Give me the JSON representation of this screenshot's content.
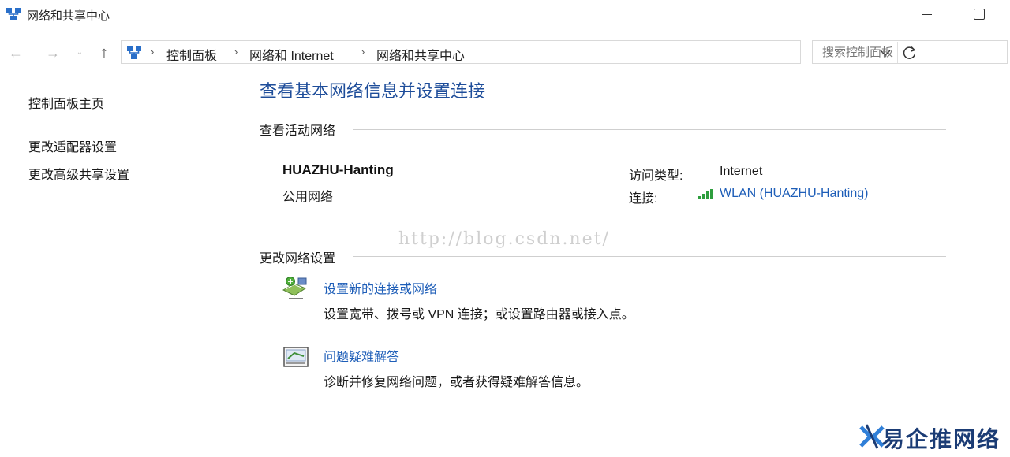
{
  "window": {
    "title": "网络和共享中心"
  },
  "navigation": {
    "back_glyph": "←",
    "forward_glyph": "→",
    "recent_glyph": "⌄",
    "up_glyph": "↑"
  },
  "address_bar": {
    "crumbs": [
      "控制面板",
      "网络和 Internet",
      "网络和共享中心"
    ],
    "separator": "›"
  },
  "search": {
    "placeholder": "搜索控制面板"
  },
  "sidebar": {
    "items": [
      {
        "label": "控制面板主页"
      },
      {
        "label": "更改适配器设置"
      },
      {
        "label": "更改高级共享设置"
      }
    ]
  },
  "main": {
    "title": "查看基本网络信息并设置连接",
    "active_networks_header": "查看活动网络",
    "network": {
      "name": "HUAZHU-Hanting",
      "type": "公用网络",
      "access_type_label": "访问类型:",
      "access_type_value": "Internet",
      "connection_label": "连接:",
      "connection_value": "WLAN (HUAZHU-Hanting)"
    },
    "watermark": "http://blog.csdn.net/",
    "change_settings_header": "更改网络设置",
    "tasks": [
      {
        "title": "设置新的连接或网络",
        "description": "设置宽带、拨号或 VPN 连接；或设置路由器或接入点。",
        "icon": "new-connection-icon"
      },
      {
        "title": "问题疑难解答",
        "description": "诊断并修复网络问题，或者获得疑难解答信息。",
        "icon": "troubleshoot-icon"
      }
    ]
  },
  "corner_brand": {
    "text": "易企推网络"
  },
  "colors": {
    "link": "#1e5eb8",
    "title": "#1e4d9a",
    "signal": "#2e9e3e",
    "brand": "#1b3c75"
  }
}
